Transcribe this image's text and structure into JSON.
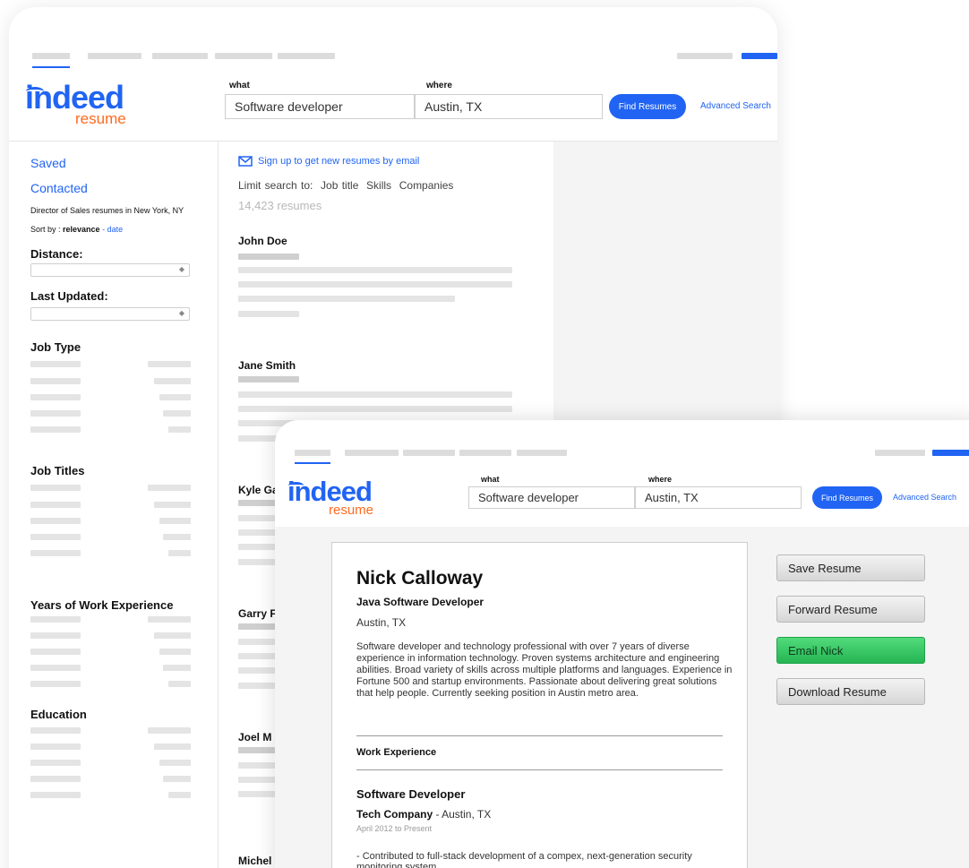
{
  "brand": {
    "name": "indeed",
    "product": "resume"
  },
  "search": {
    "what_label": "what",
    "where_label": "where",
    "what_value": "Software developer",
    "where_value": "Austin, TX",
    "find_label": "Find Resumes",
    "advanced_label": "Advanced Search"
  },
  "sidebar": {
    "saved": "Saved",
    "contacted": "Contacted",
    "context": "Director of Sales resumes in New York, NY",
    "sort_prefix": "Sort by : ",
    "sort_active": "relevance",
    "sort_sep": " - ",
    "sort_alt": "date",
    "distance_label": "Distance:",
    "last_updated_label": "Last Updated:",
    "sections": [
      "Job Type",
      "Job Titles",
      "Years of Work Experience",
      "Education"
    ]
  },
  "results": {
    "signup": "Sign up to get new resumes by email",
    "limit": "Limit search to:  Job title  Skills  Companies",
    "count": "14,423 resumes",
    "names": [
      "John Doe",
      "Jane Smith",
      "Kyle Ga",
      "Garry F",
      "Joel M",
      "Michel"
    ]
  },
  "resume": {
    "name": "Nick Calloway",
    "title": "Java Software Developer",
    "location": "Austin, TX",
    "summary": "Software developer and technology professional with over 7 years of diverse experience in information technology. Proven systems architecture and engineering abilities. Broad variety of skills across multiple platforms and languages. Experience in Fortune 500 and startup environments. Passionate about delivering great solutions that help people. Currently seeking position in Austin metro area.",
    "section_work": "Work Experience",
    "job_title": "Software Developer",
    "company": "Tech Company",
    "company_suffix": " - Austin, TX",
    "dates": "April 2012 to Present",
    "bullet": "- Contributed to full-stack development of a compex, next-generation security monitoring system"
  },
  "actions": {
    "save": "Save Resume",
    "forward": "Forward Resume",
    "email": "Email Nick",
    "download": "Download Resume"
  },
  "colors": {
    "brand_blue": "#2164f3",
    "brand_orange": "#ff6a1f",
    "action_green": "#3ccb67"
  }
}
